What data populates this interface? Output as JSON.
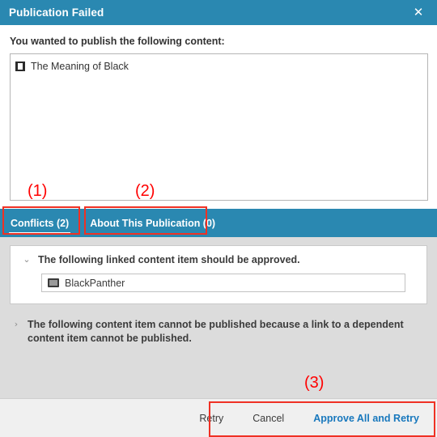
{
  "dialog": {
    "title": "Publication Failed",
    "close_icon": "close-icon"
  },
  "upper": {
    "prompt": "You wanted to publish the following content:",
    "items": [
      {
        "label": "The Meaning of Black",
        "icon": "page-icon"
      }
    ]
  },
  "tabs": [
    {
      "label": "Conflicts (2)",
      "active": true
    },
    {
      "label": "About This Publication (0)",
      "active": false
    }
  ],
  "conflicts": [
    {
      "chevron": "chevron-down-icon",
      "title": "The following linked content item should be approved.",
      "linked_items": [
        {
          "label": "BlackPanther",
          "icon": "media-icon"
        }
      ]
    },
    {
      "chevron": "chevron-right-icon",
      "title": "The following content item cannot be published because a link to a dependent content item cannot be published."
    }
  ],
  "footer": {
    "buttons": [
      {
        "label": "Retry",
        "primary": false
      },
      {
        "label": "Cancel",
        "primary": false
      },
      {
        "label": "Approve All and Retry",
        "primary": true
      }
    ]
  },
  "annotations": [
    {
      "number": "(1)"
    },
    {
      "number": "(2)"
    },
    {
      "number": "(3)"
    }
  ],
  "colors": {
    "accent": "#2a88b1",
    "annotation": "#ef3124",
    "link": "#1878bd",
    "pane_bg": "#dcdcdc",
    "footer_bg": "#f0f0f0"
  }
}
